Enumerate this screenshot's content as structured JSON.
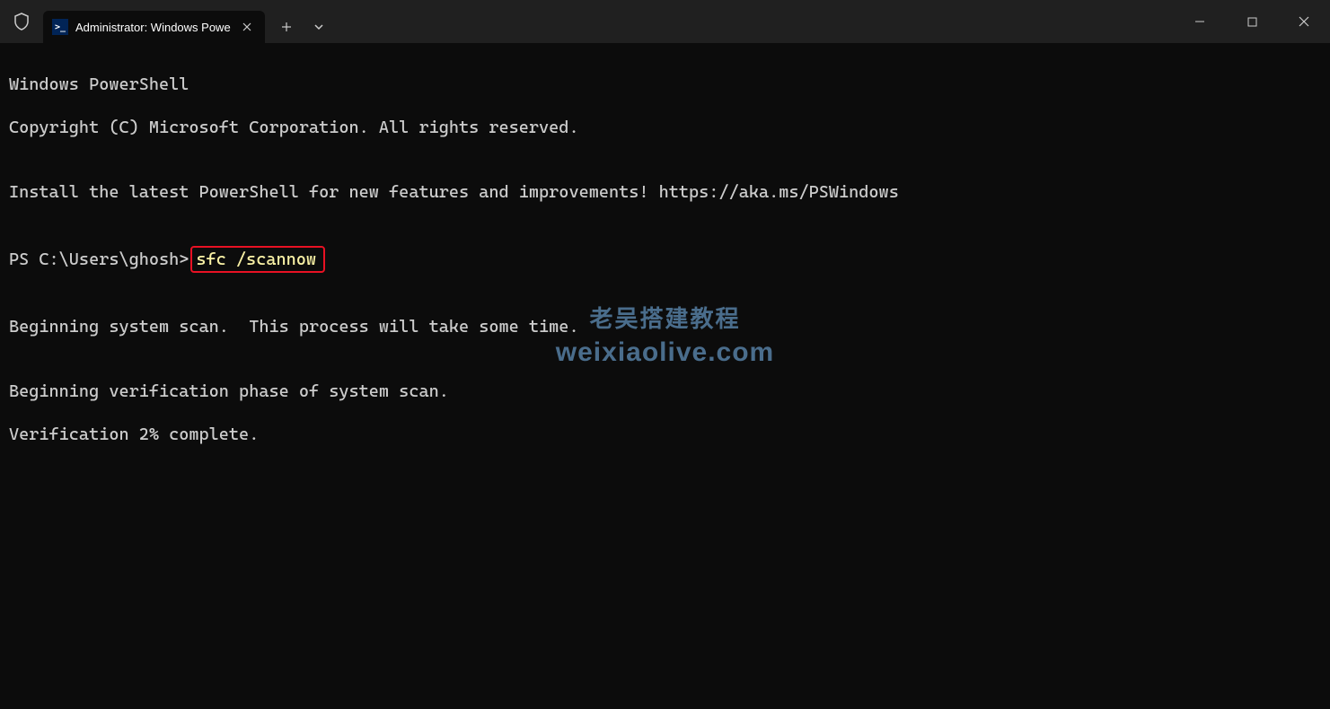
{
  "titlebar": {
    "tabTitle": "Administrator: Windows Powe",
    "tabIconText": ">_"
  },
  "terminal": {
    "line1": "Windows PowerShell",
    "line2": "Copyright (C) Microsoft Corporation. All rights reserved.",
    "line3": "",
    "line4": "Install the latest PowerShell for new features and improvements! https://aka.ms/PSWindows",
    "line5": "",
    "prompt": "PS C:\\Users\\ghosh>",
    "command": "sfc /scannow",
    "line7": "",
    "line8": "Beginning system scan.  This process will take some time.",
    "line9": "",
    "line10": "Beginning verification phase of system scan.",
    "line11": "Verification 2% complete."
  },
  "watermark": {
    "line1": "老吴搭建教程",
    "line2": "weixiaolive.com"
  }
}
